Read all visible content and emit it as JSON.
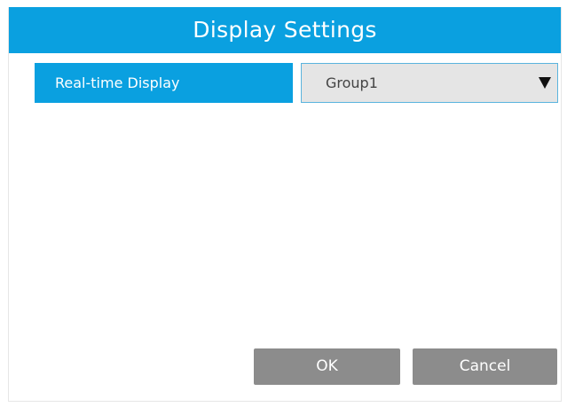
{
  "dialog": {
    "title": "Display Settings"
  },
  "realtime_display": {
    "label": "Real-time Display",
    "selected_value": "Group1",
    "dropdown_icon": "caret-down-icon"
  },
  "buttons": {
    "ok_label": "OK",
    "cancel_label": "Cancel"
  },
  "colors": {
    "accent": "#0aa0e0",
    "button": "#8c8c8c",
    "select_bg": "#e5e5e5"
  }
}
